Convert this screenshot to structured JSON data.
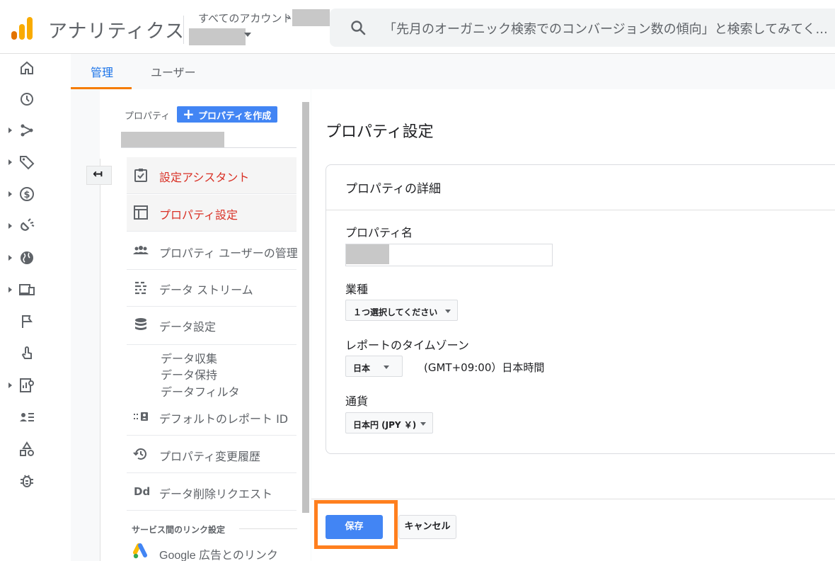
{
  "header": {
    "app_title": "アナリティクス",
    "breadcrumb": "すべてのアカウント",
    "breadcrumb_chevron": "›",
    "search_placeholder": "「先月のオーガニック検索でのコンバージョン数の傾向」と検索してみてく...",
    "logo_colors": [
      "#f9ab00",
      "#e37400"
    ]
  },
  "rail": {
    "icons": [
      "home-icon",
      "clock-icon",
      "explore-icon",
      "tag-icon",
      "dollar-icon",
      "magnet-icon",
      "globe-icon",
      "devices-icon",
      "flag-icon",
      "touch-icon",
      "report-icon",
      "person-list-icon",
      "shapes-icon",
      "bug-icon"
    ]
  },
  "tabs": {
    "admin": "管理",
    "user": "ユーザー"
  },
  "property_column": {
    "label": "プロパティ",
    "create_button": "プロパティを作成",
    "create_plus": "+",
    "back_arrow": "↤",
    "menu": [
      {
        "label": "設定アシスタント",
        "icon": "checklist-icon",
        "active": true
      },
      {
        "label": "プロパティ設定",
        "icon": "layout-icon",
        "active": true
      },
      {
        "label": "プロパティ ユーザーの管理",
        "icon": "people-icon",
        "active": false
      },
      {
        "label": "データ ストリーム",
        "icon": "stream-icon",
        "active": false
      },
      {
        "label": "データ設定",
        "icon": "database-icon",
        "active": false
      },
      {
        "label": "デフォルトのレポート ID",
        "icon": "id-card-icon",
        "active": false
      },
      {
        "label": "プロパティ変更履歴",
        "icon": "history-icon",
        "active": false
      },
      {
        "label": "データ削除リクエスト",
        "icon": "dd-icon",
        "active": false
      }
    ],
    "data_settings_sub": [
      "データ収集",
      "データ保持",
      "データフィルタ"
    ],
    "dd_glyph": "Dd",
    "section_head": "サービス間のリンク設定",
    "google_ads_link": "Google 広告とのリンク"
  },
  "main": {
    "page_title": "プロパティ設定",
    "card_title": "プロパティの詳細",
    "property_name_label": "プロパティ名",
    "industry_label": "業種",
    "industry_value": "１つ選択してください",
    "timezone_label": "レポートのタイムゾーン",
    "timezone_country": "日本",
    "timezone_value": "(GMT+09:00）日本時間",
    "currency_label": "通貨",
    "currency_value": "日本円 (JPY ￥)",
    "save_button": "保存",
    "cancel_button": "キャンセル"
  },
  "colors": {
    "accent_blue": "#4285f4",
    "active_red": "#d93025",
    "highlight_orange": "#ff7f1e",
    "tab_underline": "#f57c00"
  }
}
